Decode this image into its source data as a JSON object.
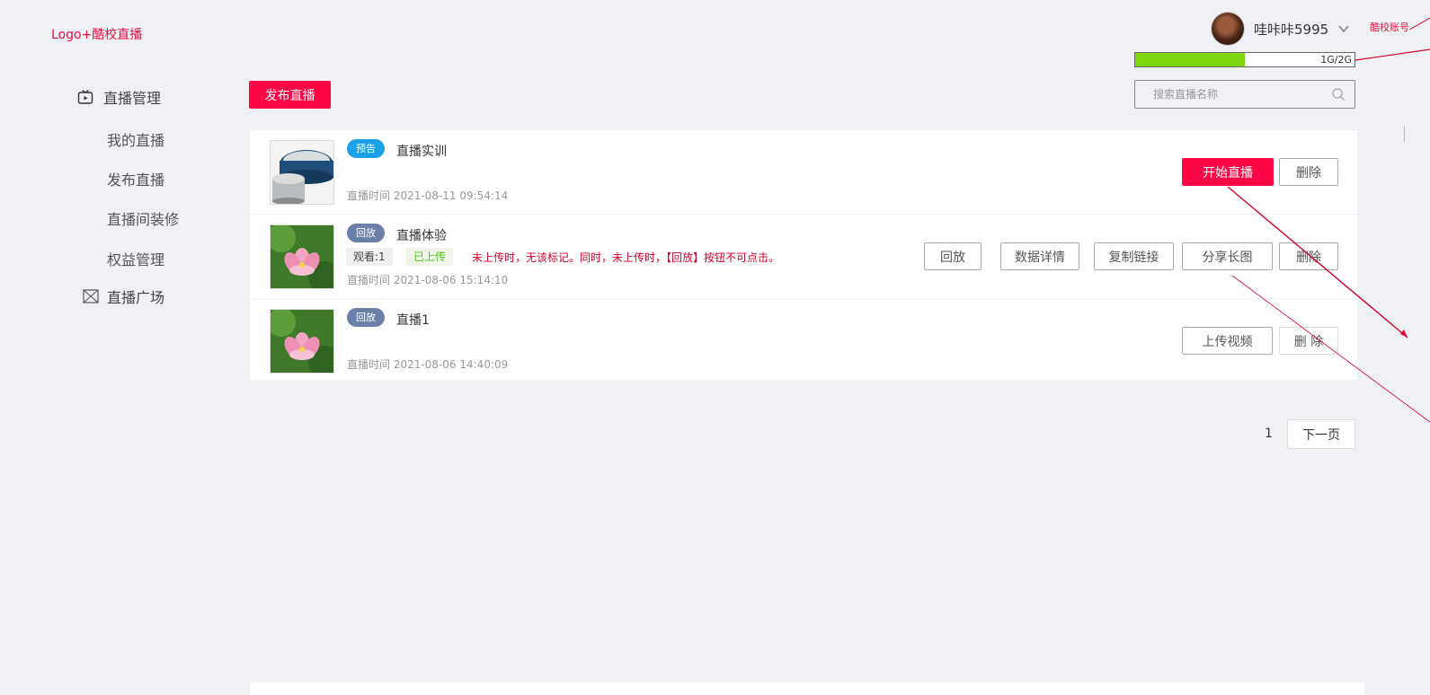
{
  "header": {
    "logo_text": "Logo+酷校直播",
    "username": "哇咔咔5995",
    "storage": {
      "used_label": "1G/2G",
      "used_fraction": 0.5
    },
    "annotation_text": "酷校账号"
  },
  "sidebar": {
    "group_manage": "直播管理",
    "items": [
      {
        "label": "我的直播"
      },
      {
        "label": "发布直播"
      },
      {
        "label": "直播间装修"
      },
      {
        "label": "权益管理"
      }
    ],
    "group_plaza": "直播广场"
  },
  "toolbar": {
    "publish_label": "发布直播",
    "search_placeholder": "搜索直播名称"
  },
  "lives": [
    {
      "badge": "预告",
      "title": "直播实训",
      "time": "直播时间 2021-08-11 09:54:14",
      "buttons": [
        "开始直播",
        "删除"
      ]
    },
    {
      "badge": "回放",
      "title": "直播体验",
      "views": "观看:1",
      "upload_status": "已上传",
      "note": "未上传时，无该标记。同时，未上传时，【回放】按钮不可点击。",
      "time": "直播时间 2021-08-06 15:14:10",
      "buttons": [
        "回放",
        "数据详情",
        "复制链接",
        "分享长图",
        "删除"
      ]
    },
    {
      "badge": "回放",
      "title": "直播1",
      "time": "直播时间 2021-08-06 14:40:09",
      "buttons": [
        "上传视频",
        "删 除"
      ]
    }
  ],
  "pagination": {
    "current": "1",
    "next_label": "下一页"
  },
  "colors": {
    "accent": "#fe0545",
    "badge_preview": "#1aa1e6",
    "badge_replay": "#6c7fa6",
    "storage_bar": "#7ed60e",
    "annotation": "#e8103f",
    "uploaded_text": "#52c41a"
  },
  "icons": {
    "live_tv": "tv-icon",
    "plaza": "envelope-icon",
    "search": "search-icon",
    "dropdown": "chevron-down-icon"
  }
}
